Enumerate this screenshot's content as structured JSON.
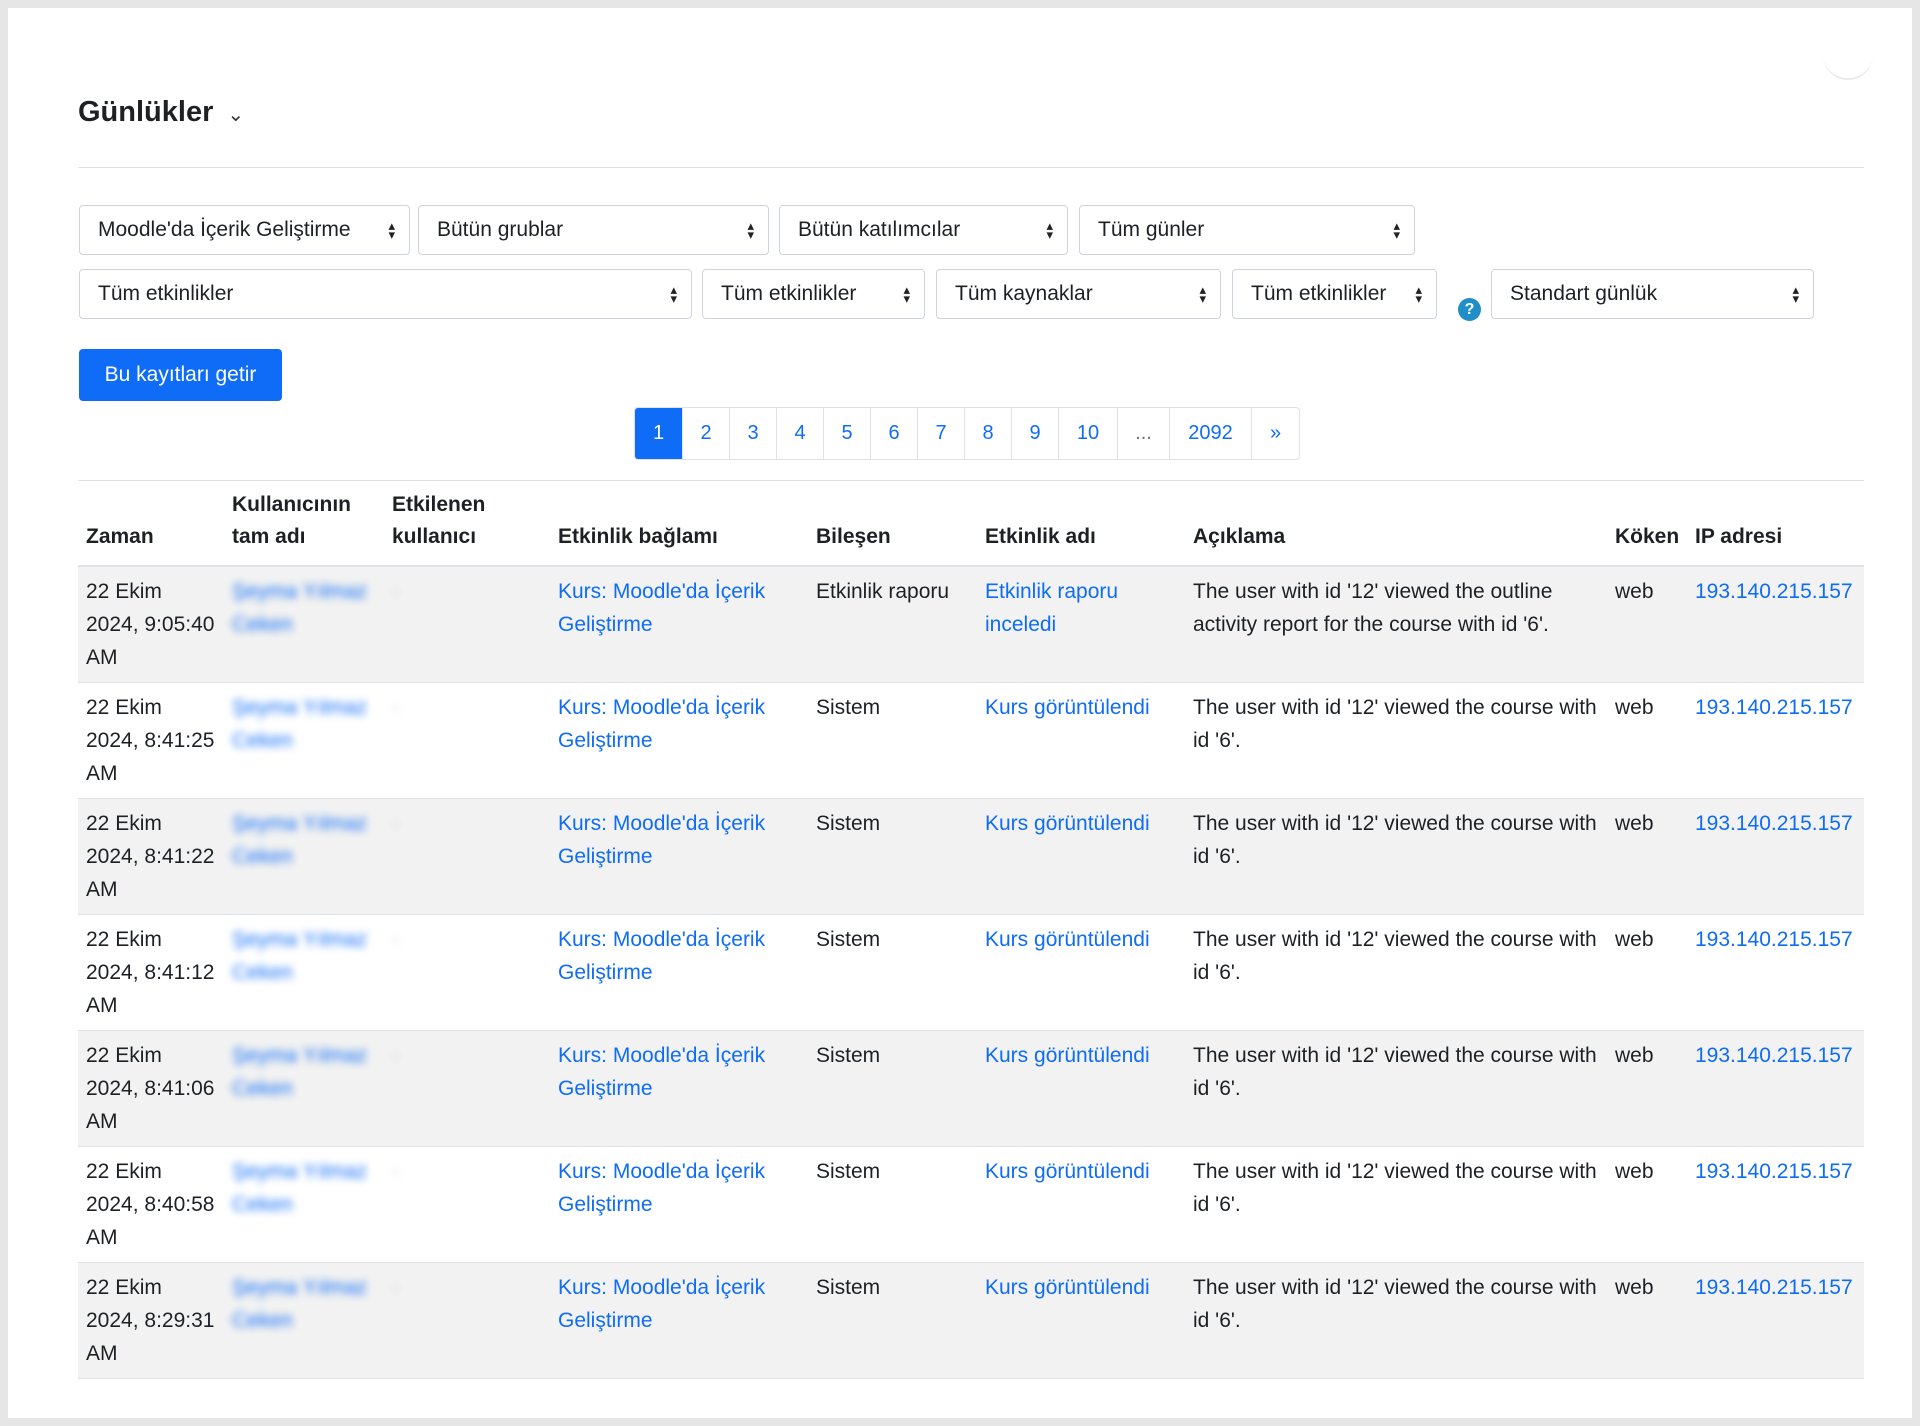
{
  "page": {
    "title": "Günlükler",
    "chevron": "⌄"
  },
  "filters": {
    "course": "Moodle'da İçerik Geliştirme",
    "groups": "Bütün grublar",
    "participants": "Bütün katılımcılar",
    "days": "Tüm günler",
    "activities": "Tüm etkinlikler",
    "actions": "Tüm etkinlikler",
    "sources": "Tüm kaynaklar",
    "edulevel": "Tüm etkinlikler",
    "logreader": "Standart günlük",
    "help_icon": "?"
  },
  "submit_label": "Bu kayıtları getir",
  "pagination": {
    "pages": [
      "1",
      "2",
      "3",
      "4",
      "5",
      "6",
      "7",
      "8",
      "9",
      "10",
      "...",
      "2092",
      "»"
    ],
    "active": "1"
  },
  "table": {
    "headers": {
      "time": "Zaman",
      "fullname": "Kullanıcının tam adı",
      "affected": "Etkilenen kullanıcı",
      "context": "Etkinlik bağlamı",
      "component": "Bileşen",
      "eventname": "Etkinlik adı",
      "description": "Açıklama",
      "origin": "Köken",
      "ip": "IP adresi"
    },
    "rows": [
      {
        "time": "22 Ekim 2024, 9:05:40 AM",
        "user": "Şeyma Yılmaz Ceken",
        "affected": "-",
        "context": "Kurs: Moodle'da İçerik Geliştirme",
        "component": "Etkinlik raporu",
        "event": "Etkinlik raporu inceledi",
        "description": "The user with id '12' viewed the outline activity report for the course with id '6'.",
        "origin": "web",
        "ip": "193.140.215.157"
      },
      {
        "time": "22 Ekim 2024, 8:41:25 AM",
        "user": "Şeyma Yılmaz Ceken",
        "affected": "-",
        "context": "Kurs: Moodle'da İçerik Geliştirme",
        "component": "Sistem",
        "event": "Kurs görüntülendi",
        "description": "The user with id '12' viewed the course with id '6'.",
        "origin": "web",
        "ip": "193.140.215.157"
      },
      {
        "time": "22 Ekim 2024, 8:41:22 AM",
        "user": "Şeyma Yılmaz Ceken",
        "affected": "-",
        "context": "Kurs: Moodle'da İçerik Geliştirme",
        "component": "Sistem",
        "event": "Kurs görüntülendi",
        "description": "The user with id '12' viewed the course with id '6'.",
        "origin": "web",
        "ip": "193.140.215.157"
      },
      {
        "time": "22 Ekim 2024, 8:41:12 AM",
        "user": "Şeyma Yılmaz Ceken",
        "affected": "-",
        "context": "Kurs: Moodle'da İçerik Geliştirme",
        "component": "Sistem",
        "event": "Kurs görüntülendi",
        "description": "The user with id '12' viewed the course with id '6'.",
        "origin": "web",
        "ip": "193.140.215.157"
      },
      {
        "time": "22 Ekim 2024, 8:41:06 AM",
        "user": "Şeyma Yılmaz Ceken",
        "affected": "-",
        "context": "Kurs: Moodle'da İçerik Geliştirme",
        "component": "Sistem",
        "event": "Kurs görüntülendi",
        "description": "The user with id '12' viewed the course with id '6'.",
        "origin": "web",
        "ip": "193.140.215.157"
      },
      {
        "time": "22 Ekim 2024, 8:40:58 AM",
        "user": "Şeyma Yılmaz Ceken",
        "affected": "-",
        "context": "Kurs: Moodle'da İçerik Geliştirme",
        "component": "Sistem",
        "event": "Kurs görüntülendi",
        "description": "The user with id '12' viewed the course with id '6'.",
        "origin": "web",
        "ip": "193.140.215.157"
      },
      {
        "time": "22 Ekim 2024, 8:29:31 AM",
        "user": "Şeyma Yılmaz Ceken",
        "affected": "-",
        "context": "Kurs: Moodle'da İçerik Geliştirme",
        "component": "Sistem",
        "event": "Kurs görüntülendi",
        "description": "The user with id '12' viewed the course with id '6'.",
        "origin": "web",
        "ip": "193.140.215.157"
      }
    ]
  }
}
